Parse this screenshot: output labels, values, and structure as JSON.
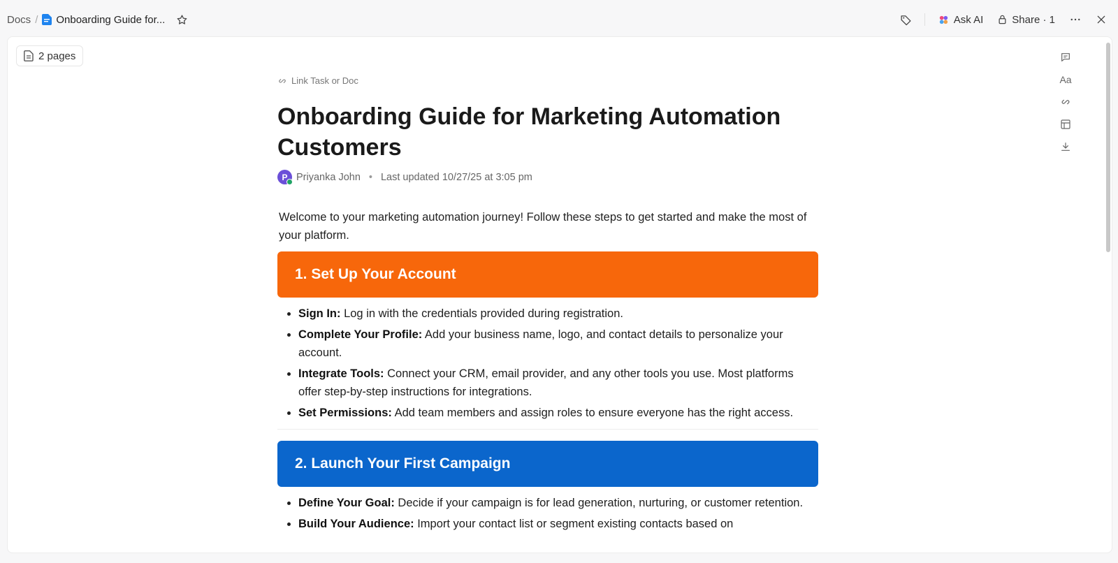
{
  "breadcrumb": {
    "root": "Docs",
    "separator": "/",
    "doc": "Onboarding Guide for..."
  },
  "topbar": {
    "ask_ai": "Ask AI",
    "share": "Share · 1"
  },
  "pages_button": "2 pages",
  "doc": {
    "link_task": "Link Task or Doc",
    "title": "Onboarding Guide for Marketing Automation Customers",
    "author_initial": "P",
    "author": "Priyanka John",
    "last_updated": "Last updated 10/27/25 at 3:05 pm",
    "intro": "Welcome to your marketing automation journey! Follow these steps to get started and make the most of your platform.",
    "sections": [
      {
        "heading": "1. Set Up Your Account",
        "color": "#f7670b",
        "items": [
          {
            "bold": "Sign In:",
            "text": " Log in with the credentials provided during registration."
          },
          {
            "bold": "Complete Your Profile:",
            "text": " Add your business name, logo, and contact details to personalize your account."
          },
          {
            "bold": "Integrate Tools:",
            "text": " Connect your CRM, email provider, and any other tools you use. Most platforms offer step-by-step instructions for integrations."
          },
          {
            "bold": "Set Permissions:",
            "text": " Add team members and assign roles to ensure everyone has the right access."
          }
        ]
      },
      {
        "heading": "2. Launch Your First Campaign",
        "color": "#0b66cc",
        "items": [
          {
            "bold": "Define Your Goal:",
            "text": " Decide if your campaign is for lead generation, nurturing, or customer retention."
          },
          {
            "bold": "Build Your Audience:",
            "text": " Import your contact list or segment existing contacts based on"
          }
        ]
      }
    ]
  },
  "icons": {
    "doc": "doc-file-icon",
    "star": "star-icon",
    "tag": "tag-icon",
    "ai": "ai-sparkle-icon",
    "lock": "lock-icon",
    "more": "more-icon",
    "close": "close-icon",
    "pages": "pages-icon",
    "comment": "comment-icon",
    "font": "font-icon",
    "link": "link-icon",
    "layout": "layout-icon",
    "download": "download-icon"
  }
}
